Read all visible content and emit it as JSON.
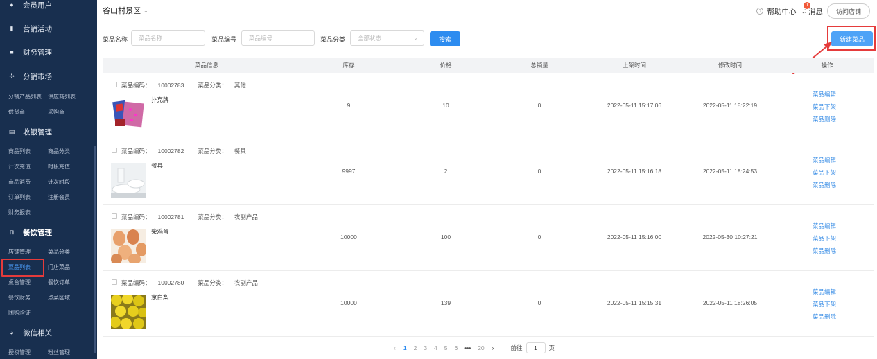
{
  "sidebar": {
    "sections": [
      {
        "label": "会员用户",
        "icon": "user-group-icon"
      },
      {
        "label": "营销活动",
        "icon": "bar-chart-icon"
      },
      {
        "label": "财务管理",
        "icon": "wallet-icon"
      },
      {
        "label": "分销市场",
        "icon": "share-icon"
      },
      {
        "label": "收银管理",
        "icon": "cashier-icon"
      },
      {
        "label": "餐饮管理",
        "icon": "bag-icon"
      },
      {
        "label": "微信相关",
        "icon": "wechat-icon"
      }
    ],
    "distribution_items": [
      "分销产品列表",
      "供应商列表",
      "供货商",
      "采购商"
    ],
    "cashier_items": [
      "商品列表",
      "商品分类",
      "计次充值",
      "时段充值",
      "商品消费",
      "计次时段",
      "订单列表",
      "注册会员",
      "财务报表"
    ],
    "catering_items": [
      "店铺管理",
      "菜品分类",
      "菜品列表",
      "门店菜品",
      "桌台管理",
      "餐饮订单",
      "餐饮财务",
      "点菜区域",
      "团购验证"
    ],
    "wechat_items": [
      "授权管理",
      "粉丝管理"
    ]
  },
  "header": {
    "title": "谷山村景区",
    "help": "帮助中心",
    "messages": "消息",
    "message_badge": "1",
    "visit_store": "访问店铺"
  },
  "filters": {
    "name_label": "菜品名称",
    "name_placeholder": "菜品名称",
    "code_label": "菜品编号",
    "code_placeholder": "菜品编号",
    "category_label": "菜品分类",
    "category_value": "全部状态",
    "search_button": "搜索",
    "new_button": "新建菜品"
  },
  "table": {
    "headers": [
      "菜品信息",
      "库存",
      "价格",
      "总销量",
      "上架时间",
      "修改时间",
      "操作"
    ],
    "code_prefix": "菜品编码：",
    "category_prefix": "菜品分类：",
    "ops": [
      "菜品编辑",
      "菜品下架",
      "菜品删除"
    ],
    "rows": [
      {
        "code": "10002783",
        "category": "其他",
        "name": "扑克牌",
        "stock": "9",
        "price": "10",
        "sales": "0",
        "listed": "2022-05-11 15:17:06",
        "modified": "2022-05-11 18:22:19"
      },
      {
        "code": "10002782",
        "category": "餐具",
        "name": "餐具",
        "stock": "9997",
        "price": "2",
        "sales": "0",
        "listed": "2022-05-11 15:16:18",
        "modified": "2022-05-11 18:24:53"
      },
      {
        "code": "10002781",
        "category": "农副产品",
        "name": "柴鸡蛋",
        "stock": "10000",
        "price": "100",
        "sales": "0",
        "listed": "2022-05-11 15:16:00",
        "modified": "2022-05-30 10:27:21"
      },
      {
        "code": "10002780",
        "category": "农副产品",
        "name": "京白梨",
        "stock": "10000",
        "price": "139",
        "sales": "0",
        "listed": "2022-05-11 15:15:31",
        "modified": "2022-05-11 18:26:05"
      }
    ]
  },
  "pagination": {
    "pages": [
      "1",
      "2",
      "3",
      "4",
      "5",
      "6"
    ],
    "ellipsis": "•••",
    "last": "20",
    "goto_label": "前往",
    "goto_value": "1",
    "goto_suffix": "页"
  },
  "colors": {
    "sidebar_bg": "#182f4f",
    "primary": "#2d8cf0",
    "highlight": "#e53b3b",
    "link": "#3a8ee6"
  }
}
